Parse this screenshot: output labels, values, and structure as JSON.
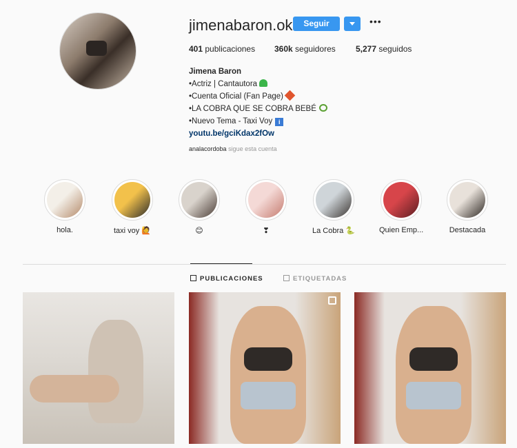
{
  "profile": {
    "username": "jimenabaron.ok",
    "follow_label": "Seguir",
    "stats": {
      "posts_count": "401",
      "posts_label": "publicaciones",
      "followers_count": "360k",
      "followers_label": "seguidores",
      "following_count": "5,277",
      "following_label": "seguidos"
    },
    "bio": {
      "name": "Jimena Baron",
      "line1": "•Actriz | Cantautora",
      "line2": "•Cuenta Oficial (Fan Page)",
      "line3": "•LA COBRA QUE SE COBRA BEBÉ",
      "line4": "•Nuevo Tema - Taxi Voy",
      "info_glyph": "i",
      "link": "youtu.be/gciKdax2fOw"
    },
    "followed_by": {
      "user": "analacordoba",
      "text": "sigue esta cuenta"
    }
  },
  "highlights": [
    {
      "label": "hola.",
      "colors": [
        "#f3efe8",
        "#b48a6a"
      ]
    },
    {
      "label": "taxi voy 🙋",
      "colors": [
        "#f2c14b",
        "#2b2b2b"
      ]
    },
    {
      "label": "😊",
      "colors": [
        "#d9d3cc",
        "#4a3c35"
      ]
    },
    {
      "label": "❣",
      "colors": [
        "#f4d9d6",
        "#c57b6f"
      ]
    },
    {
      "label": "La Cobra 🐍",
      "colors": [
        "#cfd5d9",
        "#3b3531"
      ]
    },
    {
      "label": "Quien Emp...",
      "colors": [
        "#d7454a",
        "#5a1e22"
      ]
    },
    {
      "label": "Destacada",
      "colors": [
        "#e8e1da",
        "#2d2722"
      ]
    }
  ],
  "tabs": {
    "posts": "PUBLICACIONES",
    "tagged": "ETIQUETADAS"
  }
}
